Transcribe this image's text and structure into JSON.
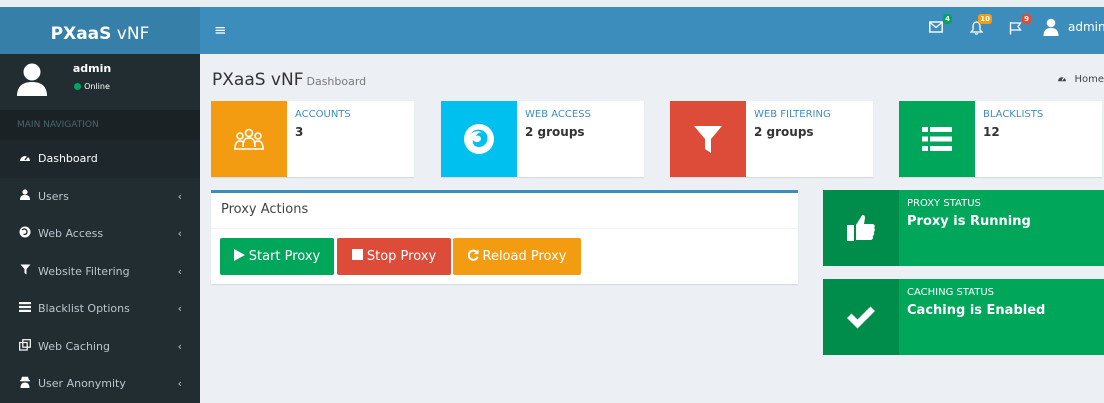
{
  "app": {
    "logo_bold": "PXaaS",
    "logo_rest": " vNF"
  },
  "navbar": {
    "menu_icon": "hamburger-icon",
    "messages_badge": "4",
    "notifications_badge": "10",
    "tasks_badge": "9",
    "username": "admin"
  },
  "sidebar": {
    "user_name": "admin",
    "user_status": "Online",
    "nav_header": "MAIN NAVIGATION",
    "items": [
      {
        "label": "Dashboard",
        "icon": "dashboard-icon"
      },
      {
        "label": "Users",
        "icon": "users-icon"
      },
      {
        "label": "Web Access",
        "icon": "firefox-icon"
      },
      {
        "label": "Website Filtering",
        "icon": "filter-icon"
      },
      {
        "label": "Blacklist Options",
        "icon": "list-icon"
      },
      {
        "label": "Web Caching",
        "icon": "clone-icon"
      },
      {
        "label": "User Anonymity",
        "icon": "user-secret-icon"
      }
    ]
  },
  "page": {
    "title": "PXaaS vNF",
    "subtitle": "Dashboard",
    "breadcrumb": "Home"
  },
  "info_boxes": [
    {
      "label": "ACCOUNTS",
      "value": "3",
      "color": "#f39c12",
      "icon": "users-group-icon"
    },
    {
      "label": "WEB ACCESS",
      "value": "2 groups",
      "color": "#00c0ef",
      "icon": "firefox-icon"
    },
    {
      "label": "WEB FILTERING",
      "value": "2 groups",
      "color": "#dd4b39",
      "icon": "filter-icon"
    },
    {
      "label": "BLACKLISTS",
      "value": "12",
      "color": "#00a65a",
      "icon": "list-icon"
    }
  ],
  "proxy_actions": {
    "title": "Proxy Actions",
    "start_label": "Start Proxy",
    "stop_label": "Stop Proxy",
    "reload_label": "Reload Proxy"
  },
  "proxy_status": {
    "label": "PROXY STATUS",
    "value": "Proxy is Running"
  },
  "caching_status": {
    "label": "CACHING STATUS",
    "value": "Caching is Enabled"
  },
  "colors": {
    "primary": "#3c8dbc",
    "success": "#00a65a",
    "danger": "#dd4b39",
    "warning": "#f39c12",
    "info": "#00c0ef",
    "sidebar_bg": "#222d32"
  }
}
